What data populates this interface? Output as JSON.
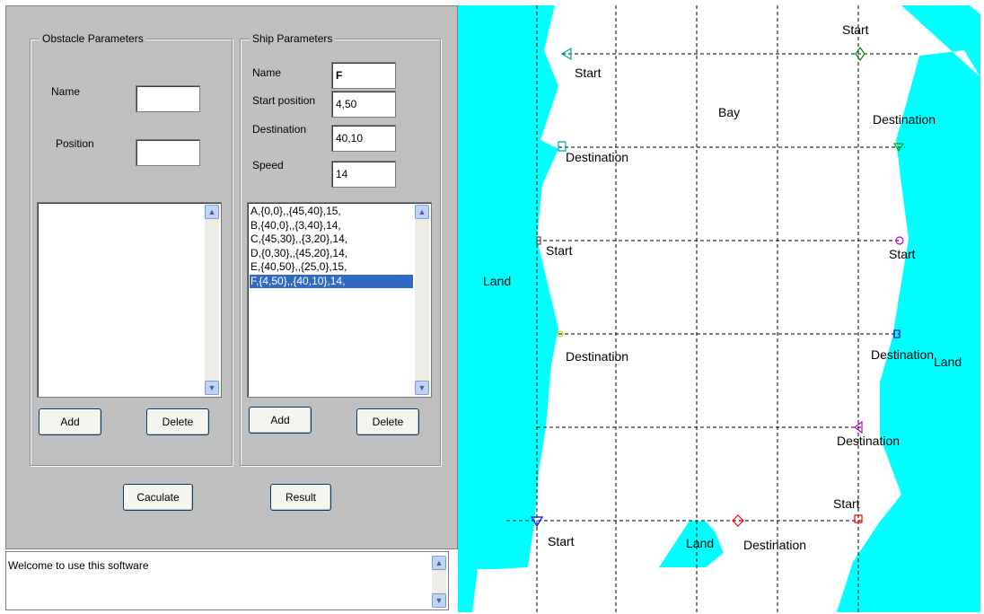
{
  "obstacle_group": {
    "title": "Obstacle Parameters",
    "name_label": "Name",
    "name_value": "",
    "position_label": "Position",
    "position_value": "",
    "items": [],
    "add_label": "Add",
    "delete_label": "Delete"
  },
  "ship_group": {
    "title": "Ship Parameters",
    "name_label": "Name",
    "name_value": "F",
    "start_label": "Start position",
    "start_value": "4,50",
    "dest_label": "Destination",
    "dest_value": "40,10",
    "speed_label": "Speed",
    "speed_value": "14",
    "items": [
      "A,{0,0},,{45,40},15,",
      "B,{40,0},,{3,40},14,",
      "C,{45,30},,{3,20},14,",
      "D,{0,30},,{45,20},14,",
      "E,{40,50},,{25,0},15,",
      "F,{4,50},,{40,10},14,"
    ],
    "selected_index": 5,
    "add_label": "Add",
    "delete_label": "Delete"
  },
  "actions": {
    "calculate_label": "Caculate",
    "result_label": "Result"
  },
  "status": {
    "message": "Welcome to use this software"
  },
  "map": {
    "labels": {
      "bay": "Bay",
      "land_left": "Land",
      "land_right": "Land",
      "land_island": "Land"
    },
    "ships": [
      {
        "id": "A",
        "color": "#ff0000",
        "marker": "square",
        "start_label": "Start",
        "dest_label": "Destination"
      },
      {
        "id": "B",
        "color": "#0000ff",
        "marker": "triangle-down",
        "start_label": "Start",
        "dest_label": "Destination"
      },
      {
        "id": "C",
        "color": "#cc00cc",
        "marker": "circle",
        "start_label": "Start",
        "dest_label": "Destination"
      },
      {
        "id": "D",
        "color": "#555555",
        "marker": "square",
        "start_label": "Start",
        "dest_label": "Destination"
      },
      {
        "id": "E",
        "color": "#008800",
        "marker": "diamond",
        "start_label": "Start",
        "dest_label": "Destination"
      },
      {
        "id": "F",
        "color": "#00aaaa",
        "marker": "triangle-left",
        "start_label": "Start",
        "dest_label": "Destination"
      }
    ],
    "colors": {
      "land": "#00ffff",
      "grid": "#000000",
      "water": "#ffffff"
    }
  }
}
